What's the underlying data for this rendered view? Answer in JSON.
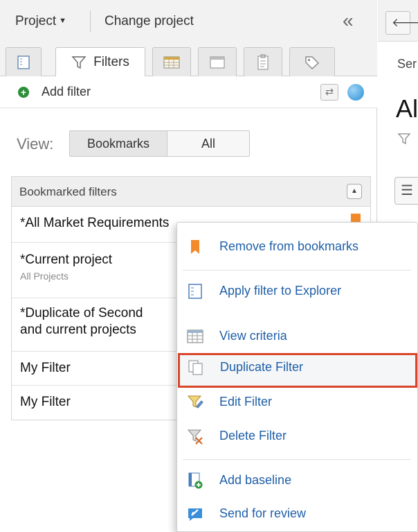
{
  "topbar": {
    "project_label": "Project",
    "change_project_label": "Change project",
    "collapse_glyph": "«"
  },
  "tabs": [
    {
      "name": "explorer-tab",
      "icon": "explorer-icon"
    },
    {
      "name": "filters-tab",
      "icon": "funnel-icon",
      "label": "Filters",
      "active": true
    },
    {
      "name": "criteria-tab",
      "icon": "grid-icon"
    },
    {
      "name": "window-tab",
      "icon": "window-icon"
    },
    {
      "name": "clipboard-tab",
      "icon": "clipboard-icon"
    },
    {
      "name": "tag-tab",
      "icon": "tag-icon"
    }
  ],
  "toolbar": {
    "add_filter_label": "Add filter",
    "sync_glyph": "⇄"
  },
  "view": {
    "label": "View:",
    "options": [
      "Bookmarks",
      "All"
    ],
    "selected": "Bookmarks"
  },
  "bookmarked": {
    "header": "Bookmarked filters",
    "rows": [
      {
        "title": "*All Market Requirements",
        "subtitle": "",
        "bookmarked": true
      },
      {
        "title": "*Current project",
        "subtitle": "All Projects"
      },
      {
        "title": "*Duplicate of Second",
        "title_line2": "and current projects"
      },
      {
        "title": "My Filter"
      },
      {
        "title": "My Filter"
      }
    ]
  },
  "right_strip": {
    "back_glyph": "🡐",
    "se_text": "Ser",
    "al_text": "Al"
  },
  "context_menu": {
    "items": [
      {
        "label": "Remove from bookmarks",
        "icon": "bookmark-icon"
      },
      {
        "label": "Apply filter to Explorer",
        "icon": "explorer-icon"
      },
      {
        "label": "View criteria",
        "icon": "grid-icon"
      },
      {
        "label": "Duplicate Filter",
        "icon": "duplicate-icon",
        "highlighted": true
      },
      {
        "label": "Edit Filter",
        "icon": "edit-filter-icon"
      },
      {
        "label": "Delete Filter",
        "icon": "delete-filter-icon"
      },
      {
        "label": "Add baseline",
        "icon": "add-baseline-icon"
      },
      {
        "label": "Send for review",
        "icon": "send-review-icon"
      }
    ]
  },
  "colors": {
    "accent_link": "#1f5fa8",
    "highlight_border": "#d9452b",
    "bookmark": "#f28a2c",
    "add_green": "#2d8f3a"
  }
}
